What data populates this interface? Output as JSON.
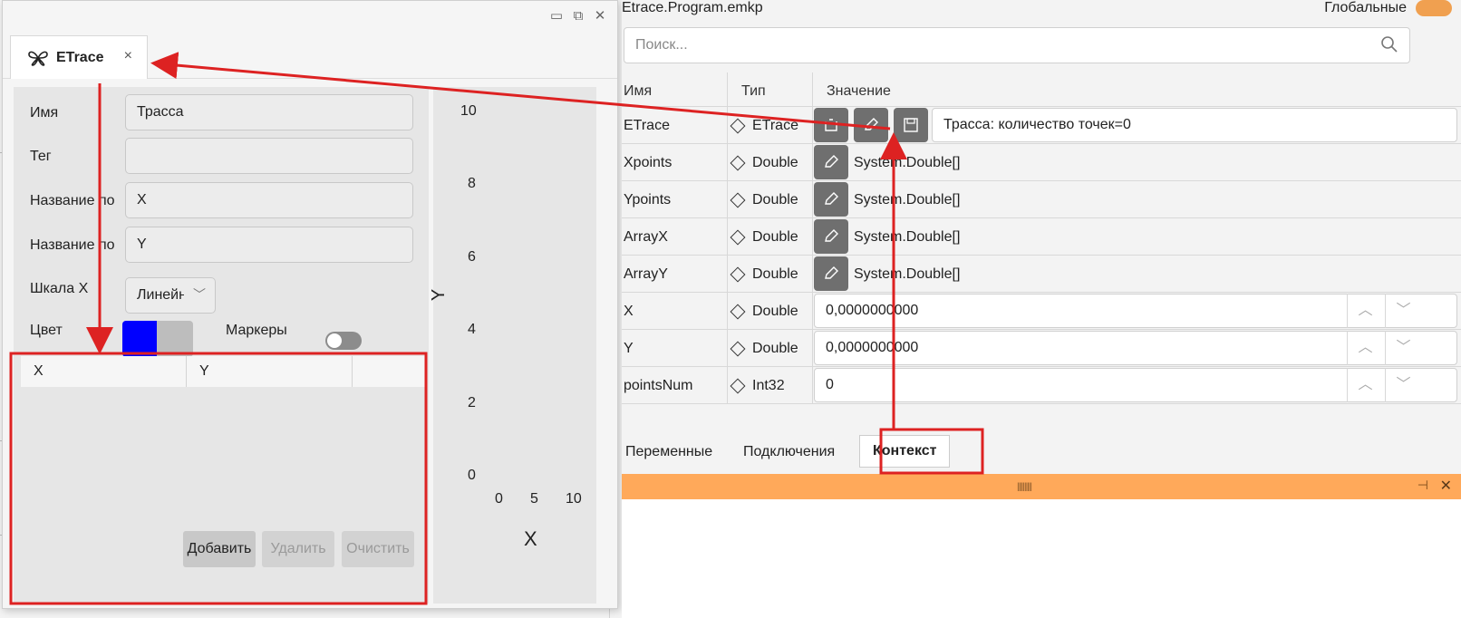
{
  "window": {
    "tab_label": "ETrace",
    "tab_close": "×",
    "controls": [
      "▭",
      "⧉",
      "✕"
    ]
  },
  "form": {
    "name_label": "Имя",
    "name_value": "Трасса",
    "tag_label": "Тег",
    "tag_value": "",
    "xname_label": "Название по",
    "xname_value": "X",
    "yname_label": "Название по",
    "yname_value": "Y",
    "scale_label": "Шкала X",
    "scale_value": "Линейная",
    "color_label": "Цвет",
    "color_primary": "#0000ff",
    "color_secondary": "#bdbdbd",
    "markers_label": "Маркеры",
    "markers_on": false,
    "grid_columns": [
      "X",
      "Y"
    ],
    "add_button": "Добавить",
    "delete_button": "Удалить",
    "clear_button": "Очистить"
  },
  "chart_data": {
    "type": "line",
    "x": [],
    "y": [],
    "xlabel": "X",
    "ylabel": "Y",
    "xlim": [
      0,
      10
    ],
    "ylim": [
      0,
      10
    ],
    "yticks": [
      "10",
      "8",
      "6",
      "4",
      "2",
      "0"
    ],
    "xticks": [
      "0",
      "5",
      "10"
    ]
  },
  "right": {
    "title": "Etrace.Program.emkp",
    "global_label": "Глобальные",
    "search_placeholder": "Поиск...",
    "headers": {
      "name": "Имя",
      "type": "Тип",
      "value": "Значение"
    },
    "rows": [
      {
        "name": "ETrace",
        "type": "ETrace",
        "value": "Трасса: количество точек=0"
      },
      {
        "name": "Xpoints",
        "type": "Double",
        "value": "System.Double[]"
      },
      {
        "name": "Ypoints",
        "type": "Double",
        "value": "System.Double[]"
      },
      {
        "name": "ArrayX",
        "type": "Double",
        "value": "System.Double[]"
      },
      {
        "name": "ArrayY",
        "type": "Double",
        "value": "System.Double[]"
      },
      {
        "name": "X",
        "type": "Double",
        "value": "0,0000000000"
      },
      {
        "name": "Y",
        "type": "Double",
        "value": "0,0000000000"
      },
      {
        "name": "pointsNum",
        "type": "Int32",
        "value": "0"
      }
    ],
    "bottom_tabs": [
      "Переменные",
      "Подключения",
      "Контекст"
    ],
    "active_tab": "Контекст",
    "accent": "#ffa95a",
    "annotation_color": "#dd2222"
  }
}
